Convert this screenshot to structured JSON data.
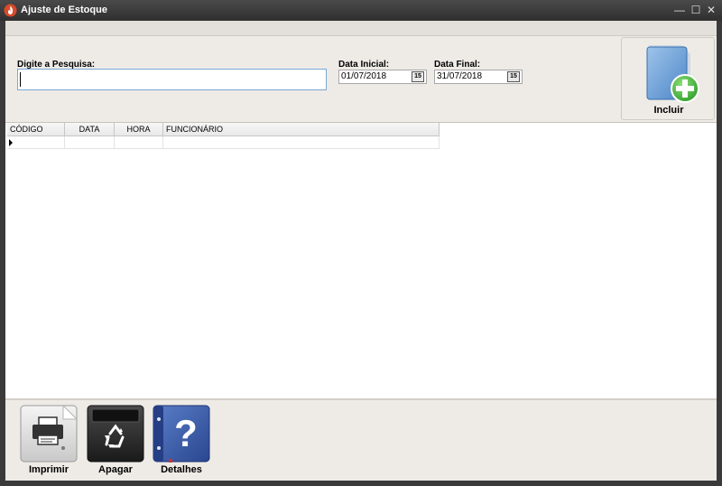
{
  "window": {
    "title": "Ajuste de Estoque",
    "controls": {
      "minimize": "—",
      "maximize": "☐",
      "close": "✕"
    }
  },
  "search": {
    "label": "Digite a Pesquisa:",
    "value": ""
  },
  "date_start": {
    "label": "Data Inicial:",
    "value": "01/07/2018",
    "button_label": "15"
  },
  "date_end": {
    "label": "Data Final:",
    "value": "31/07/2018",
    "button_label": "15"
  },
  "actions": {
    "include": "Incluir",
    "print": "Imprimir",
    "delete": "Apagar",
    "details": "Detalhes"
  },
  "grid": {
    "columns": [
      "CÓDIGO",
      "DATA",
      "HORA",
      "FUNCIONÁRIO"
    ]
  },
  "colors": {
    "titlebar": "#333333",
    "accent_blue": "#3a5ea8",
    "add_green": "#3cb043"
  }
}
